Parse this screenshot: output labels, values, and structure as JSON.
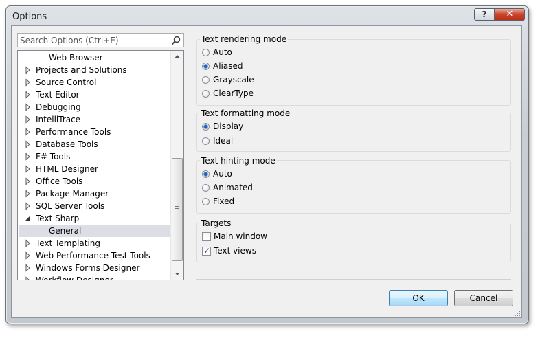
{
  "window": {
    "title": "Options",
    "help_glyph": "?",
    "close_glyph": "✕"
  },
  "search": {
    "placeholder": "Search Options (Ctrl+E)"
  },
  "tree": {
    "items": [
      {
        "label": "Web Browser",
        "expander": "none",
        "indent": 1
      },
      {
        "label": "Projects and Solutions",
        "expander": "collapsed",
        "indent": 0
      },
      {
        "label": "Source Control",
        "expander": "collapsed",
        "indent": 0
      },
      {
        "label": "Text Editor",
        "expander": "collapsed",
        "indent": 0
      },
      {
        "label": "Debugging",
        "expander": "collapsed",
        "indent": 0
      },
      {
        "label": "IntelliTrace",
        "expander": "collapsed",
        "indent": 0
      },
      {
        "label": "Performance Tools",
        "expander": "collapsed",
        "indent": 0
      },
      {
        "label": "Database Tools",
        "expander": "collapsed",
        "indent": 0
      },
      {
        "label": "F# Tools",
        "expander": "collapsed",
        "indent": 0
      },
      {
        "label": "HTML Designer",
        "expander": "collapsed",
        "indent": 0
      },
      {
        "label": "Office Tools",
        "expander": "collapsed",
        "indent": 0
      },
      {
        "label": "Package Manager",
        "expander": "collapsed",
        "indent": 0
      },
      {
        "label": "SQL Server Tools",
        "expander": "collapsed",
        "indent": 0
      },
      {
        "label": "Text Sharp",
        "expander": "expanded",
        "indent": 0
      },
      {
        "label": "General",
        "expander": "none",
        "indent": 1,
        "selected": true
      },
      {
        "label": "Text Templating",
        "expander": "collapsed",
        "indent": 0
      },
      {
        "label": "Web Performance Test Tools",
        "expander": "collapsed",
        "indent": 0
      },
      {
        "label": "Windows Forms Designer",
        "expander": "collapsed",
        "indent": 0
      },
      {
        "label": "Workflow Designer",
        "expander": "collapsed",
        "indent": 0
      }
    ]
  },
  "groups": {
    "rendering": {
      "title": "Text rendering mode",
      "options": [
        {
          "label": "Auto",
          "checked": false
        },
        {
          "label": "Aliased",
          "checked": true
        },
        {
          "label": "Grayscale",
          "checked": false
        },
        {
          "label": "ClearType",
          "checked": false
        }
      ]
    },
    "formatting": {
      "title": "Text formatting mode",
      "options": [
        {
          "label": "Display",
          "checked": true
        },
        {
          "label": "Ideal",
          "checked": false
        }
      ]
    },
    "hinting": {
      "title": "Text hinting mode",
      "options": [
        {
          "label": "Auto",
          "checked": true
        },
        {
          "label": "Animated",
          "checked": false
        },
        {
          "label": "Fixed",
          "checked": false
        }
      ]
    },
    "targets": {
      "title": "Targets",
      "options": [
        {
          "label": "Main window",
          "checked": false
        },
        {
          "label": "Text views",
          "checked": true
        }
      ]
    }
  },
  "buttons": {
    "ok": "OK",
    "cancel": "Cancel"
  },
  "colors": {
    "selection": "#dcdde5",
    "radio_dot": "#2a5fb6",
    "default_button_border": "#3c7fb1"
  }
}
